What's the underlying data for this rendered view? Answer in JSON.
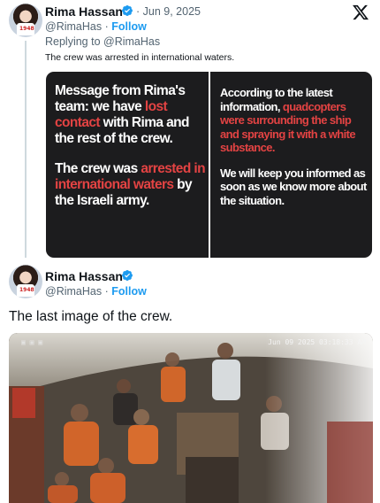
{
  "tweet1": {
    "author_name": "Rima Hassan",
    "dot": "·",
    "date": "Jun 9, 2025",
    "handle": "@RimaHas",
    "follow_sep": "·",
    "follow_label": "Follow",
    "replying_to": "Replying to @RimaHas",
    "text": "The crew was arrested in international waters.",
    "image": {
      "left_p1": [
        {
          "t": "Message from Rima's team: we have ",
          "red": false
        },
        {
          "t": "lost contact",
          "red": true
        },
        {
          "t": " with Rima and the rest of the crew.",
          "red": false
        }
      ],
      "left_p2": [
        {
          "t": "The crew was ",
          "red": false
        },
        {
          "t": "arrested in international waters",
          "red": true
        },
        {
          "t": " by the Israeli army.",
          "red": false
        }
      ],
      "right_p1": [
        {
          "t": "According to the latest information, ",
          "red": false
        },
        {
          "t": "quadcopters were surrounding the ship and spraying it with a white substance.",
          "red": true
        }
      ],
      "right_p2": [
        {
          "t": "We will keep you informed as soon as we know more about the situation.",
          "red": false
        }
      ],
      "text_color": "#ffffff",
      "highlight_color": "#e34343",
      "background": "#1c1c1e"
    }
  },
  "tweet2": {
    "author_name": "Rima Hassan",
    "handle": "@RimaHas",
    "follow_sep": "·",
    "follow_label": "Follow",
    "text": "The last image of the crew.",
    "photo": {
      "timestamp": "Jun 09 2025  03:18:33 AM",
      "description_icon": "cctv-photo"
    }
  },
  "avatar_bib": "1948",
  "colors": {
    "link": "#1d9bf0",
    "secondary_text": "#536471",
    "verified": "#1d9bf0"
  },
  "icons": {
    "platform_logo": "x-logo-icon",
    "verified": "verified-badge-icon"
  }
}
